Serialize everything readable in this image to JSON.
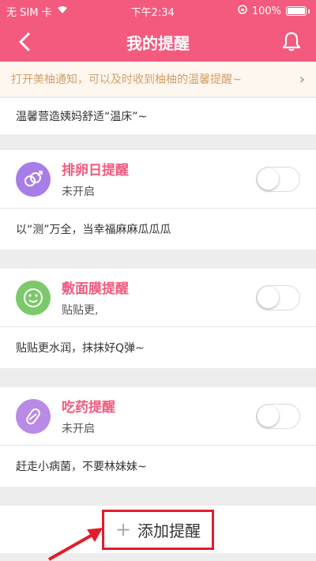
{
  "status_bar": {
    "carrier": "无 SIM 卡",
    "time": "下午2:34",
    "battery": "100%"
  },
  "nav": {
    "title": "我的提醒"
  },
  "notice": {
    "text": "打开美柚通知，可以及时收到柚柚的温馨提醒~"
  },
  "top_desc": "温馨营造姨妈舒适“温床”~",
  "reminders": [
    {
      "title": "排卵日提醒",
      "status": "未开启",
      "description": "以“测”万全，当幸福麻麻瓜瓜瓜",
      "icon": "ovulation-icon",
      "icon_color": "#a77de8"
    },
    {
      "title": "敷面膜提醒",
      "status": "贴贴更,",
      "description": "贴贴更水润，抹抹好Q弹~",
      "icon": "smile-face-icon",
      "icon_color": "#7cc96b"
    },
    {
      "title": "吃药提醒",
      "status": "未开启",
      "description": "赶走小病菌，不要林妹妹~",
      "icon": "pill-icon",
      "icon_color": "#b98ae6"
    }
  ],
  "add_button": {
    "label": "添加提醒"
  },
  "colors": {
    "brand": "#f35a7e",
    "highlight_box": "#e21c2a"
  }
}
